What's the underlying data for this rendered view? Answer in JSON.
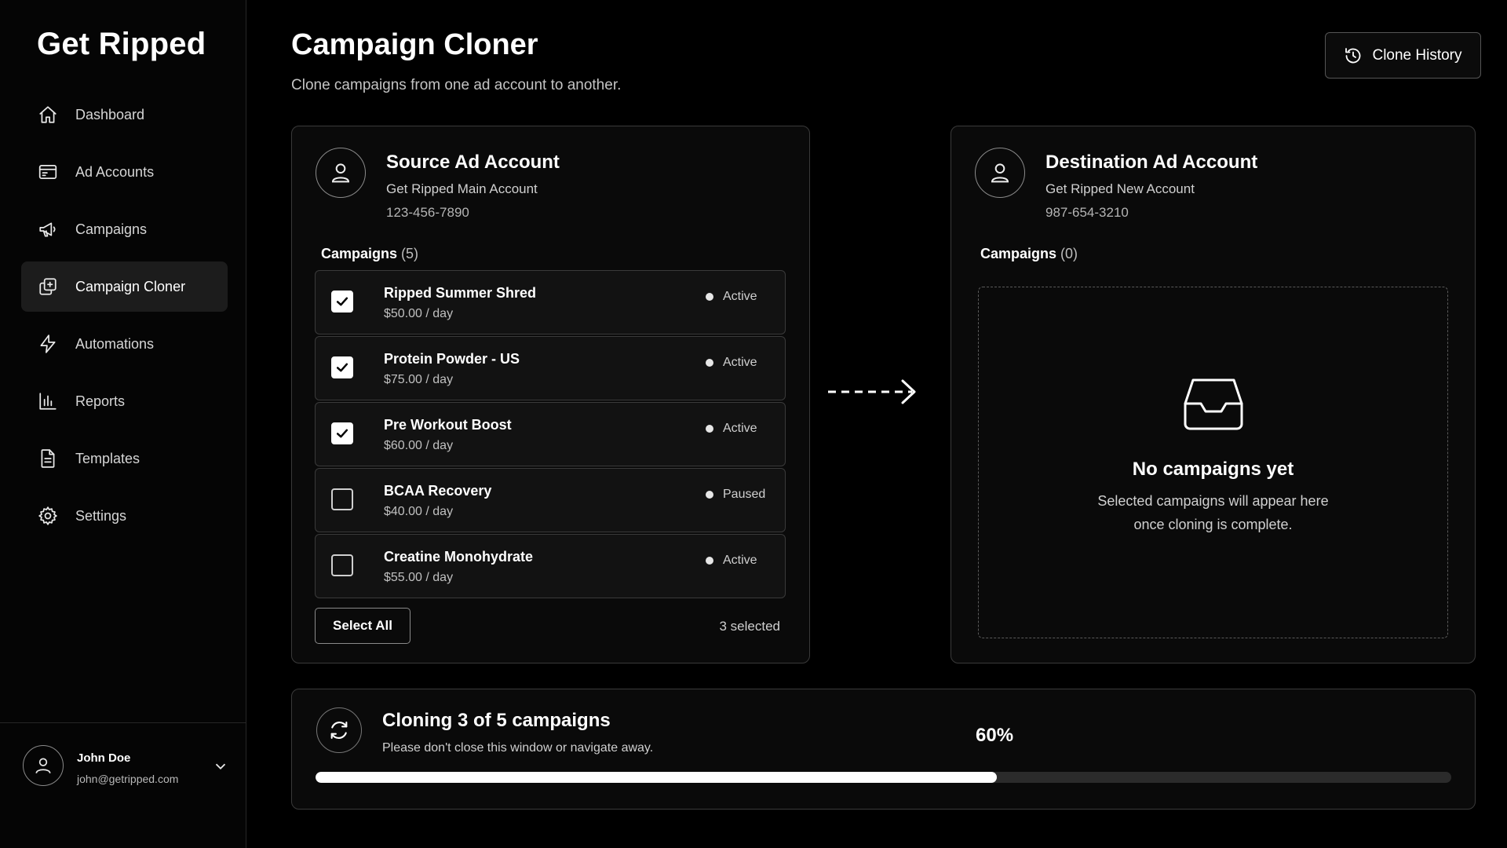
{
  "sidebar": {
    "brand": "Get Ripped",
    "items": [
      {
        "label": "Dashboard",
        "icon": "home-icon"
      },
      {
        "label": "Ad Accounts",
        "icon": "ad-accounts-icon"
      },
      {
        "label": "Campaigns",
        "icon": "megaphone-icon"
      },
      {
        "label": "Campaign Cloner",
        "icon": "clone-icon",
        "active": true
      },
      {
        "label": "Automations",
        "icon": "lightning-icon"
      },
      {
        "label": "Reports",
        "icon": "bar-chart-icon"
      },
      {
        "label": "Templates",
        "icon": "document-icon"
      },
      {
        "label": "Settings",
        "icon": "gear-icon"
      }
    ],
    "user": {
      "name": "John Doe",
      "email": "john@getripped.com"
    }
  },
  "header": {
    "title": "Campaign Cloner",
    "subtitle": "Clone campaigns from one ad account to another.",
    "history_label": "Clone History"
  },
  "source": {
    "title": "Source Ad Account",
    "account_name": "Get Ripped Main Account",
    "account_id": "123-456-7890",
    "campaigns_label": "Campaigns",
    "campaigns_count": "(5)",
    "campaigns": [
      {
        "name": "Ripped Summer Shred",
        "budget": "$50.00 / day",
        "status": "Active",
        "checked": true
      },
      {
        "name": "Protein Powder - US",
        "budget": "$75.00 / day",
        "status": "Active",
        "checked": true
      },
      {
        "name": "Pre Workout Boost",
        "budget": "$60.00 / day",
        "status": "Active",
        "checked": true
      },
      {
        "name": "BCAA Recovery",
        "budget": "$40.00 / day",
        "status": "Paused",
        "checked": false
      },
      {
        "name": "Creatine Monohydrate",
        "budget": "$55.00 / day",
        "status": "Active",
        "checked": false
      }
    ],
    "select_all_label": "Select All",
    "selected_text": "3 selected"
  },
  "destination": {
    "title": "Destination Ad Account",
    "account_name": "Get Ripped New Account",
    "account_id": "987-654-3210",
    "campaigns_label": "Campaigns",
    "campaigns_count": "(0)",
    "empty_title": "No campaigns yet",
    "empty_line1": "Selected campaigns will appear here",
    "empty_line2": "once cloning is complete."
  },
  "progress": {
    "title": "Cloning 3 of 5 campaigns",
    "subtitle": "Please don't close this window or navigate away.",
    "percent_label": "60%",
    "percent": 60
  },
  "colors": {
    "background": "#000000",
    "panel": "#0a0a0a",
    "accent": "#ffffff",
    "track": "#2b2b2b"
  }
}
